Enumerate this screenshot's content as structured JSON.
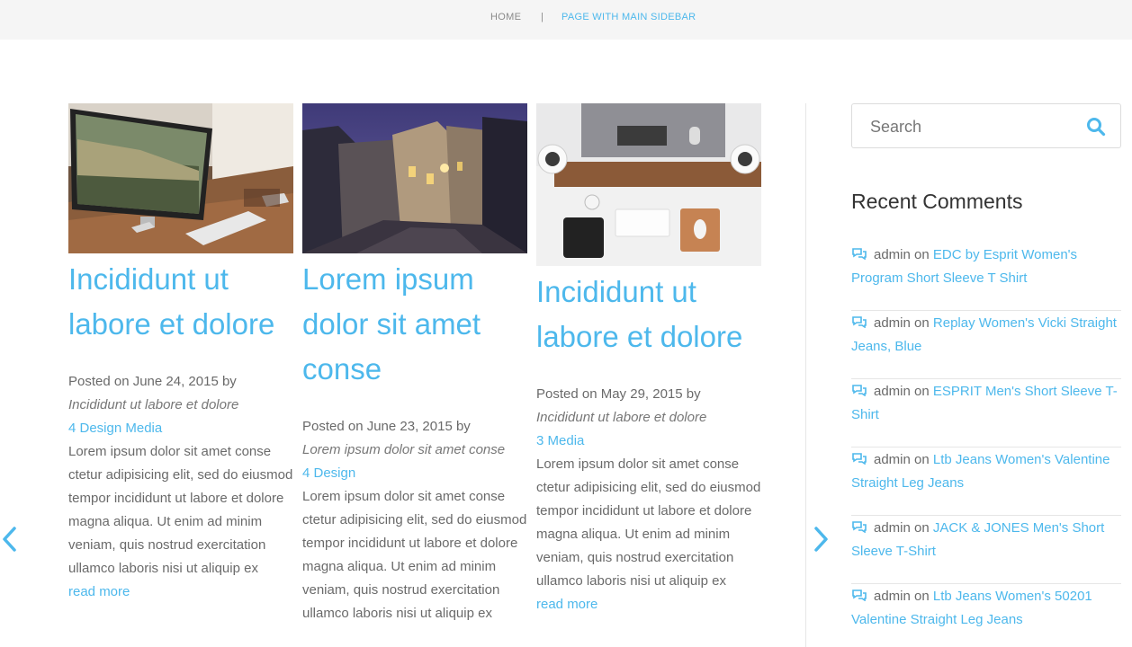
{
  "breadcrumb": {
    "home": "HOME",
    "separator": "|",
    "current": "PAGE WITH MAIN SIDEBAR"
  },
  "colors": {
    "accent": "#4db8ec",
    "text": "#6a6a6a",
    "topbar": "#f5f5f5"
  },
  "posts": [
    {
      "image": "laptop-on-desk-photo",
      "title": "Incididunt ut labore et dolore",
      "posted": "Posted on June 24, 2015 by",
      "author": "Incididunt ut labore et dolore",
      "categories": "4 Design Media",
      "excerpt": "Lorem ipsum dolor sit amet conse ctetur adipisicing elit, sed do eiusmod tempor incididunt ut labore et dolore magna aliqua. Ut enim ad minim veniam, quis nostrud exercitation ullamco laboris nisi ut aliquip ex",
      "read_more": "read more"
    },
    {
      "image": "night-street-photo",
      "title": "Lorem ipsum dolor sit amet conse",
      "posted": "Posted on June 23, 2015 by",
      "author": "Lorem ipsum dolor sit amet conse",
      "categories": "4 Design",
      "excerpt": "Lorem ipsum dolor sit amet conse ctetur adipisicing elit, sed do eiusmod tempor incididunt ut labore et dolore magna aliqua. Ut enim ad minim veniam, quis nostrud exercitation ullamco laboris nisi ut aliquip ex",
      "read_more": ""
    },
    {
      "image": "desk-top-view-photo",
      "title": "Incididunt ut labore et dolore",
      "posted": "Posted on May 29, 2015 by",
      "author": "Incididunt ut labore et dolore",
      "categories": "3 Media",
      "excerpt": "Lorem ipsum dolor sit amet conse ctetur adipisicing elit, sed do eiusmod tempor incididunt ut labore et dolore magna aliqua. Ut enim ad minim veniam, quis nostrud exercitation ullamco laboris nisi ut aliquip ex",
      "read_more": "read more"
    }
  ],
  "carousel": {
    "prev_icon": "chevron-left-icon",
    "next_icon": "chevron-right-icon"
  },
  "sidebar": {
    "search_placeholder": "Search",
    "search_icon": "search-icon",
    "recent_comments_title": "Recent Comments",
    "comment_icon": "comments-icon",
    "comments": [
      {
        "author": "admin",
        "on": "on",
        "post": "EDC by Esprit Women's Program Short Sleeve T Shirt"
      },
      {
        "author": "admin",
        "on": "on",
        "post": "Replay Women's Vicki Straight Jeans, Blue"
      },
      {
        "author": "admin",
        "on": "on",
        "post": "ESPRIT Men's Short Sleeve T-Shirt"
      },
      {
        "author": "admin",
        "on": "on",
        "post": "Ltb Jeans Women's Valentine Straight Leg Jeans"
      },
      {
        "author": "admin",
        "on": "on",
        "post": "JACK & JONES Men's Short Sleeve T-Shirt"
      },
      {
        "author": "admin",
        "on": "on",
        "post": "Ltb Jeans Women's 50201 Valentine Straight Leg Jeans"
      }
    ]
  }
}
